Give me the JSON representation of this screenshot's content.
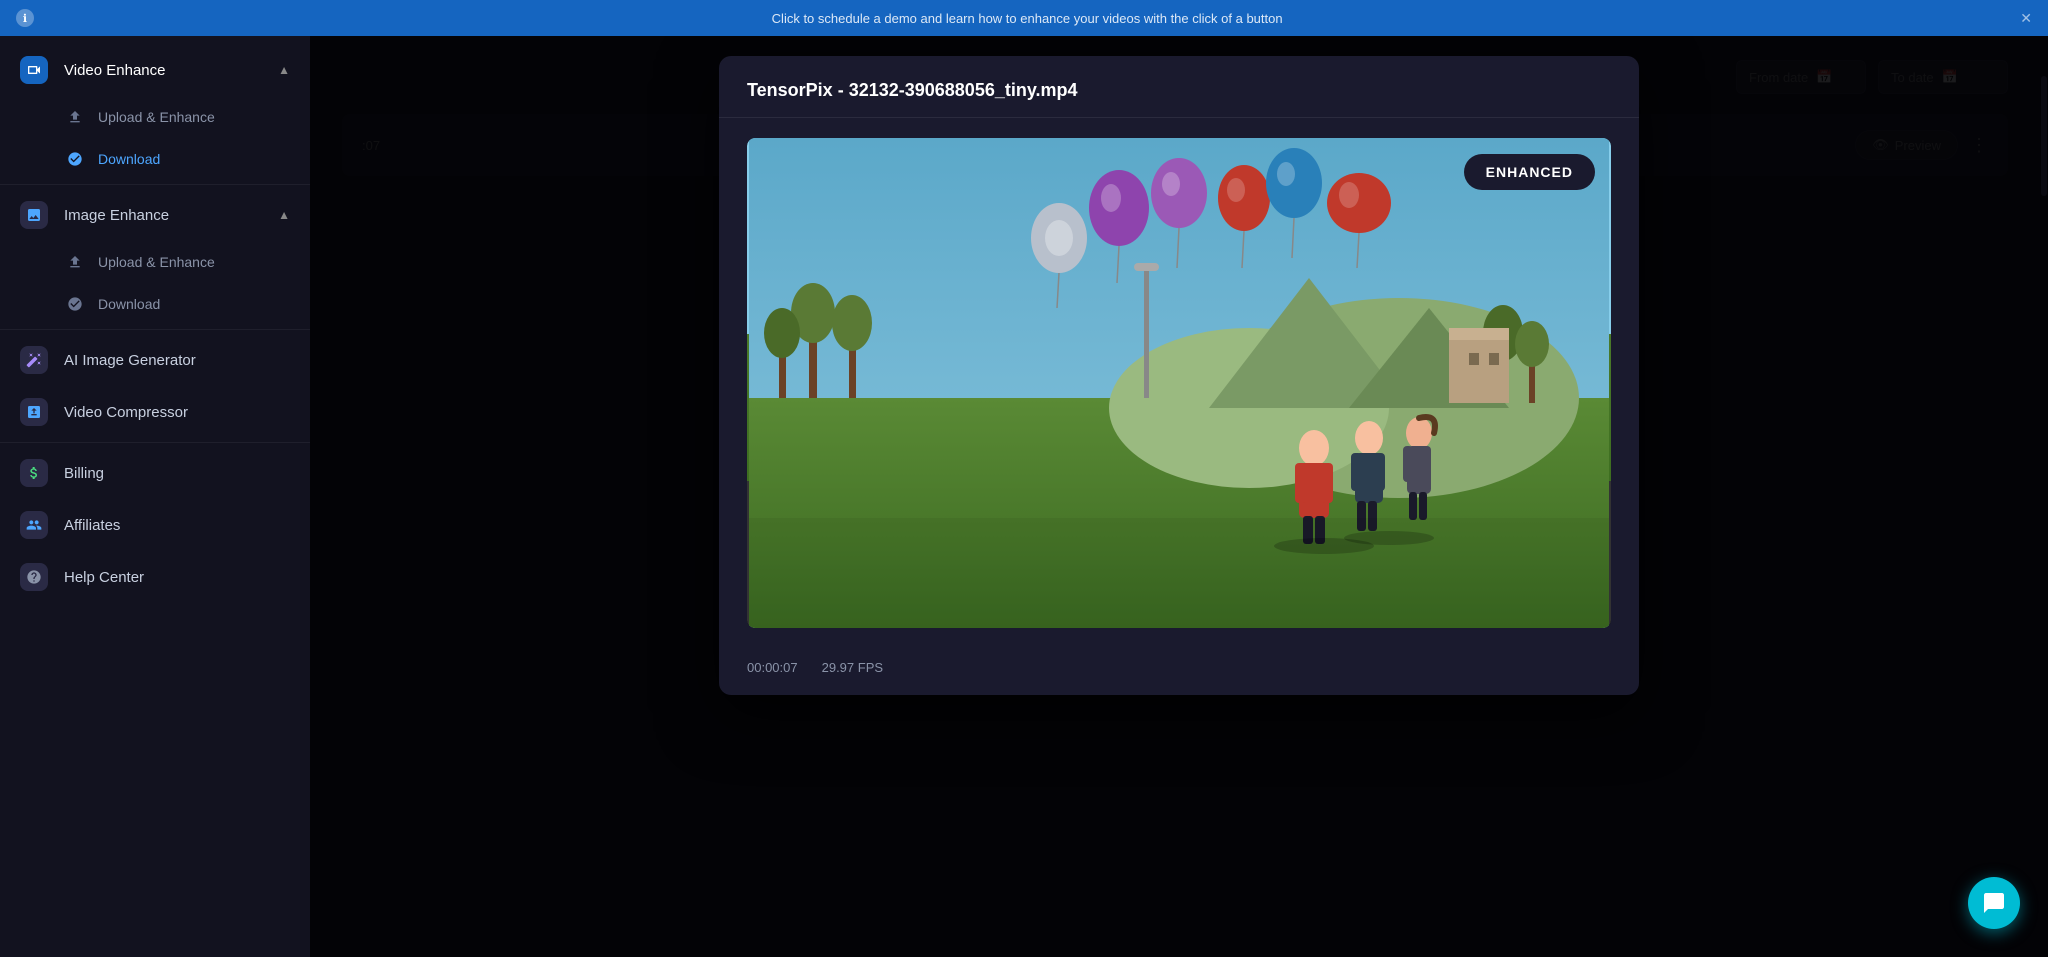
{
  "topBar": {
    "text": "Click to schedule a demo and learn how to enhance your videos with the click of a button",
    "icon": "info-icon"
  },
  "sidebar": {
    "sections": [
      {
        "id": "video-enhance",
        "label": "Video Enhance",
        "icon": "video-icon",
        "expanded": true,
        "subitems": [
          {
            "id": "upload-enhance-video",
            "label": "Upload & Enhance",
            "icon": "upload-icon",
            "active": false
          },
          {
            "id": "download-video",
            "label": "Download",
            "icon": "check-icon",
            "active": true
          }
        ]
      },
      {
        "id": "image-enhance",
        "label": "Image Enhance",
        "icon": "image-icon",
        "expanded": true,
        "subitems": [
          {
            "id": "upload-enhance-image",
            "label": "Upload & Enhance",
            "icon": "upload-icon",
            "active": false
          },
          {
            "id": "download-image",
            "label": "Download",
            "icon": "check-icon",
            "active": false
          }
        ]
      },
      {
        "id": "ai-image-generator",
        "label": "AI Image Generator",
        "icon": "wand-icon",
        "expanded": false,
        "subitems": []
      },
      {
        "id": "video-compressor",
        "label": "Video Compressor",
        "icon": "compress-icon",
        "expanded": false,
        "subitems": []
      },
      {
        "id": "billing",
        "label": "Billing",
        "icon": "dollar-icon",
        "expanded": false,
        "subitems": []
      },
      {
        "id": "affiliates",
        "label": "Affiliates",
        "icon": "affiliates-icon",
        "expanded": false,
        "subitems": []
      },
      {
        "id": "help-center",
        "label": "Help Center",
        "icon": "help-icon",
        "expanded": false,
        "subitems": []
      }
    ]
  },
  "dateFilter": {
    "fromLabel": "From date",
    "toLabel": "To date"
  },
  "tableRow": {
    "time": ":07",
    "previewLabel": "Preview",
    "moreIcon": "more-icon"
  },
  "modal": {
    "title": "TensorPix - 32132-390688056_tiny.mp4",
    "enhancedBadge": "ENHANCED",
    "timecode": "00:00:07",
    "fps": "29.97 FPS"
  },
  "chat": {
    "icon": "chat-icon"
  }
}
